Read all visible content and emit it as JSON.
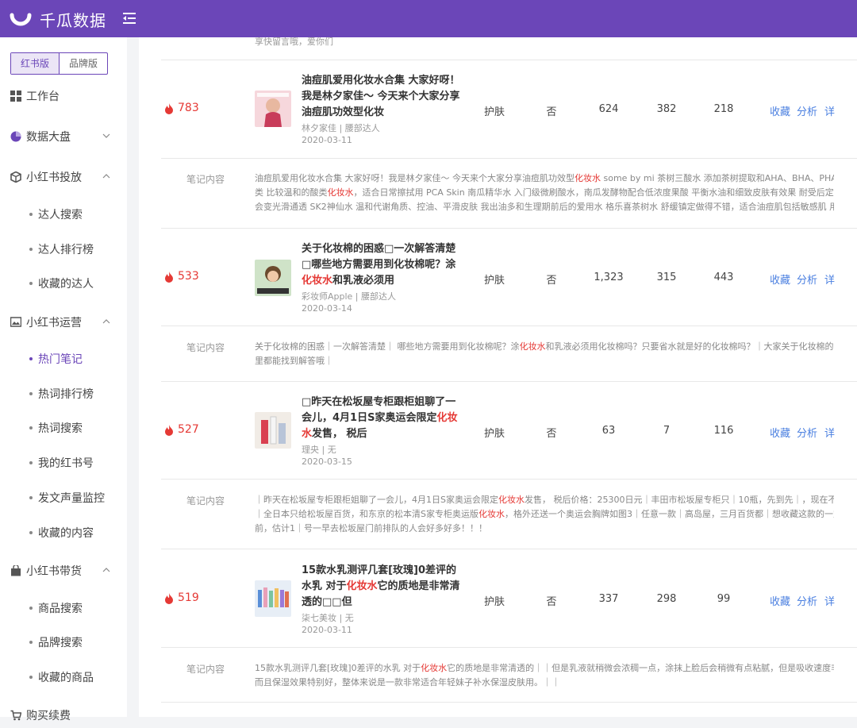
{
  "app": {
    "brand": "千瓜数据"
  },
  "sidebar": {
    "tabs": [
      "红书版",
      "品牌版"
    ],
    "items": [
      {
        "label": "工作台",
        "icon": "grid-icon"
      },
      {
        "label": "数据大盘",
        "icon": "pie-chart-icon"
      },
      {
        "label": "小红书投放",
        "icon": "cube-icon"
      },
      {
        "label": "达人搜索"
      },
      {
        "label": "达人排行榜"
      },
      {
        "label": "收藏的达人"
      },
      {
        "label": "小红书运营",
        "icon": "image-icon"
      },
      {
        "label": "热门笔记"
      },
      {
        "label": "热词排行榜"
      },
      {
        "label": "热词搜索"
      },
      {
        "label": "我的红书号"
      },
      {
        "label": "发文声量监控"
      },
      {
        "label": "收藏的内容"
      },
      {
        "label": "小红书带货",
        "icon": "bag-icon"
      },
      {
        "label": "商品搜索"
      },
      {
        "label": "品牌搜索"
      },
      {
        "label": "收藏的商品"
      },
      {
        "label": "购买续费",
        "icon": "cart-icon"
      }
    ]
  },
  "main": {
    "cut_text": "享快留言哦，爱你们",
    "content_label": "笔记内容",
    "actions": [
      "收藏",
      "分析",
      "详"
    ],
    "notes": [
      {
        "heat": "783",
        "title_parts": [
          "油痘肌爱用化妆水合集 大家好呀！我是林夕家佳～ 今天来个大家分享油痘肌功效型化妆",
          "",
          ""
        ],
        "author": "林夕家佳 | 腰部达人",
        "date": "2020-03-11",
        "category": "护肤",
        "flag": "否",
        "likes": "624",
        "collects": "382",
        "comments": "218",
        "content_lines": [
          [
            "油痘肌爱用化妆水合集 大家好呀！我是林夕家佳～ 今天来个大家分享油痘肌功效型",
            "化妆水",
            " some by mi 茶树三酸水 添加茶树提取和AHA、BHA、PHA三"
          ],
          [
            "类 比较温和的酸类",
            "化妆水",
            "，适合日常擦拭用 PCA Skin 南瓜精华水 入门级微刷酸水，南瓜发酵物配合低浓度果酸 平衡水油和细致皮肤有效果 耐受后定期"
          ],
          [
            "会变光滑通透 SK2神仙水 温和代谢角质、控油、平滑皮肤 我出油多和生理期前后的爱用水 格乐喜茶树水 舒缓镇定做得不错，适合油痘肌包括敏感肌 用来",
            "",
            ""
          ]
        ]
      },
      {
        "heat": "533",
        "title_parts": [
          "关于化妆棉的困惑□一次解答清楚□哪些地方需要用到化妆棉呢？涂",
          "化妆水",
          "和乳液必须用"
        ],
        "author": "彩妆师Apple | 腰部达人",
        "date": "2020-03-14",
        "category": "护肤",
        "flag": "否",
        "likes": "1,323",
        "collects": "315",
        "comments": "443",
        "content_lines": [
          [
            "关于化妆棉的困惑｜一次解答清楚｜ 哪些地方需要用到化妆棉呢？涂",
            "化妆水",
            "和乳液必须用化妆棉吗？只要省水就是好的化妆棉吗？｜大家关于化妆棉的困"
          ],
          [
            "里都能找到解答哦｜",
            "",
            ""
          ]
        ]
      },
      {
        "heat": "527",
        "title_parts": [
          "□昨天在松坂屋专柜跟柜姐聊了一会儿，4月1日S家奥运会限定",
          "化妆水",
          "发售， 税后"
        ],
        "author": "理央 | 无",
        "date": "2020-03-15",
        "category": "护肤",
        "flag": "否",
        "likes": "63",
        "collects": "7",
        "comments": "116",
        "content_lines": [
          [
            "｜昨天在松坂屋专柜跟柜姐聊了一会儿，4月1日S家奥运会限定",
            "化妆水",
            "发售， 税后价格：25300日元｜丰田市松坂屋专柜只｜10瓶，先到先｜，现在不给预"
          ],
          [
            "｜全日本只给松坂屋百货，和东京的松本清S家专柜奥运版",
            "化妆水",
            "，格外还送一个奥运会胸牌如图3｜任意一款｜高岛屋，三月百货都｜想收藏这款的一定"
          ],
          [
            "前，估计1｜号一早去松坂屋门前排队的人会好多好多！！！",
            "",
            ""
          ]
        ]
      },
      {
        "heat": "519",
        "title_parts": [
          "15款水乳测评几套[玫瑰]0差评的水乳 对于",
          "化妆水",
          "它的质地是非常清透的□□但"
        ],
        "author": "柒七美妆 | 无",
        "date": "2020-03-11",
        "category": "护肤",
        "flag": "否",
        "likes": "337",
        "collects": "298",
        "comments": "99",
        "content_lines": [
          [
            "15款水乳测评几套[玫瑰]0差评的水乳 对于",
            "化妆水",
            "它的质地是非常清透的｜｜但是乳液就稍微会浓稠一点，涂抹上脸后会稍微有点粘腻，但是吸收速度非常"
          ],
          [
            "而且保湿效果特别好，整体来说是一款非常适合年轻妹子补水保湿皮肤用。｜｜",
            "",
            ""
          ]
        ]
      }
    ]
  }
}
